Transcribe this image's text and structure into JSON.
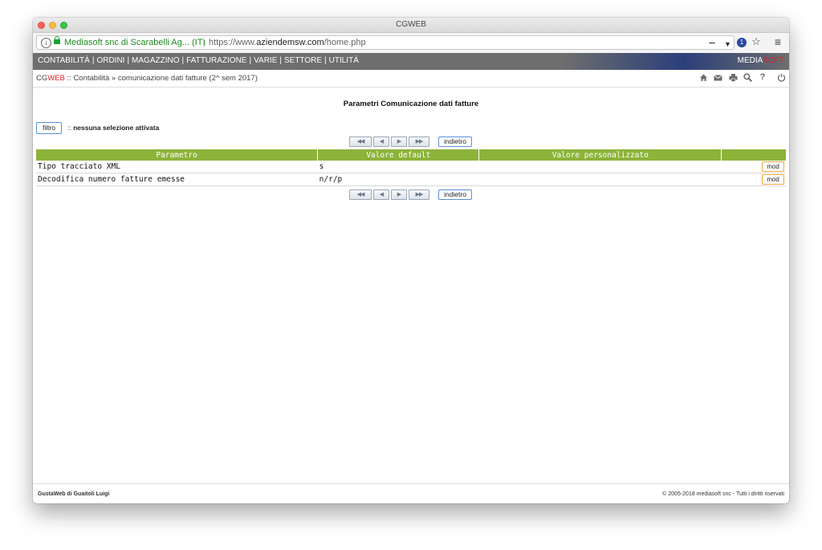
{
  "window": {
    "title": "CGWEB"
  },
  "browser": {
    "site_identity": "Mediasoft snc di Scarabelli Ag... (IT)",
    "url_prefix": "https://www.",
    "url_domain": "aziendemsw.com",
    "url_path": "/home.php",
    "more_icon": "•••",
    "pocket_icon": "▼",
    "ext_icon": "1",
    "star_icon": "☆",
    "menu_icon": "≡"
  },
  "nav": {
    "items": [
      "CONTABILITÀ",
      "ORDINI",
      "MAGAZZINO",
      "FATTURAZIONE",
      "VARIE",
      "SETTORE",
      "UTILITÀ"
    ],
    "separator": "|",
    "brand_a": "MEDIA",
    "brand_b": "SOFT"
  },
  "breadcrumb": {
    "cg": "CG",
    "web": "WEB",
    "path": " :: Contabilità » comunicazione dati fatture (2^ sem 2017)"
  },
  "toolbar_icons": [
    "home-icon",
    "mail-icon",
    "print-icon",
    "search-icon",
    "help-icon",
    "power-icon"
  ],
  "page": {
    "title": "Parametri Comunicazione dati fatture",
    "filter_button": "filtro",
    "filter_status_prefix": ":: ",
    "filter_status": "nessuna selezione attivata",
    "pager": {
      "first": "◀◀",
      "prev": "◀",
      "next": "▶",
      "last": "▶▶",
      "back": "indietro"
    }
  },
  "table": {
    "headers": [
      "Parametro",
      "Valore default",
      "Valore personalizzato",
      ""
    ],
    "rows": [
      {
        "parametro": "Tipo tracciato XML",
        "default": "s",
        "personalizzato": "",
        "action": "mod"
      },
      {
        "parametro": "Decodifica numero fatture emesse",
        "default": "n/r/p",
        "personalizzato": "",
        "action": "mod"
      }
    ]
  },
  "footer": {
    "left": "GustaWeb di Guaitoli Luigi",
    "right": "© 2005-2018 mediasoft snc - Tutti i diritti riservati"
  },
  "colors": {
    "nav_bg": "#6e6e6e",
    "header_green": "#8db33a",
    "brand_red": "#e02020",
    "button_blue": "#5a8fd8",
    "mod_orange": "#e8a93a"
  }
}
